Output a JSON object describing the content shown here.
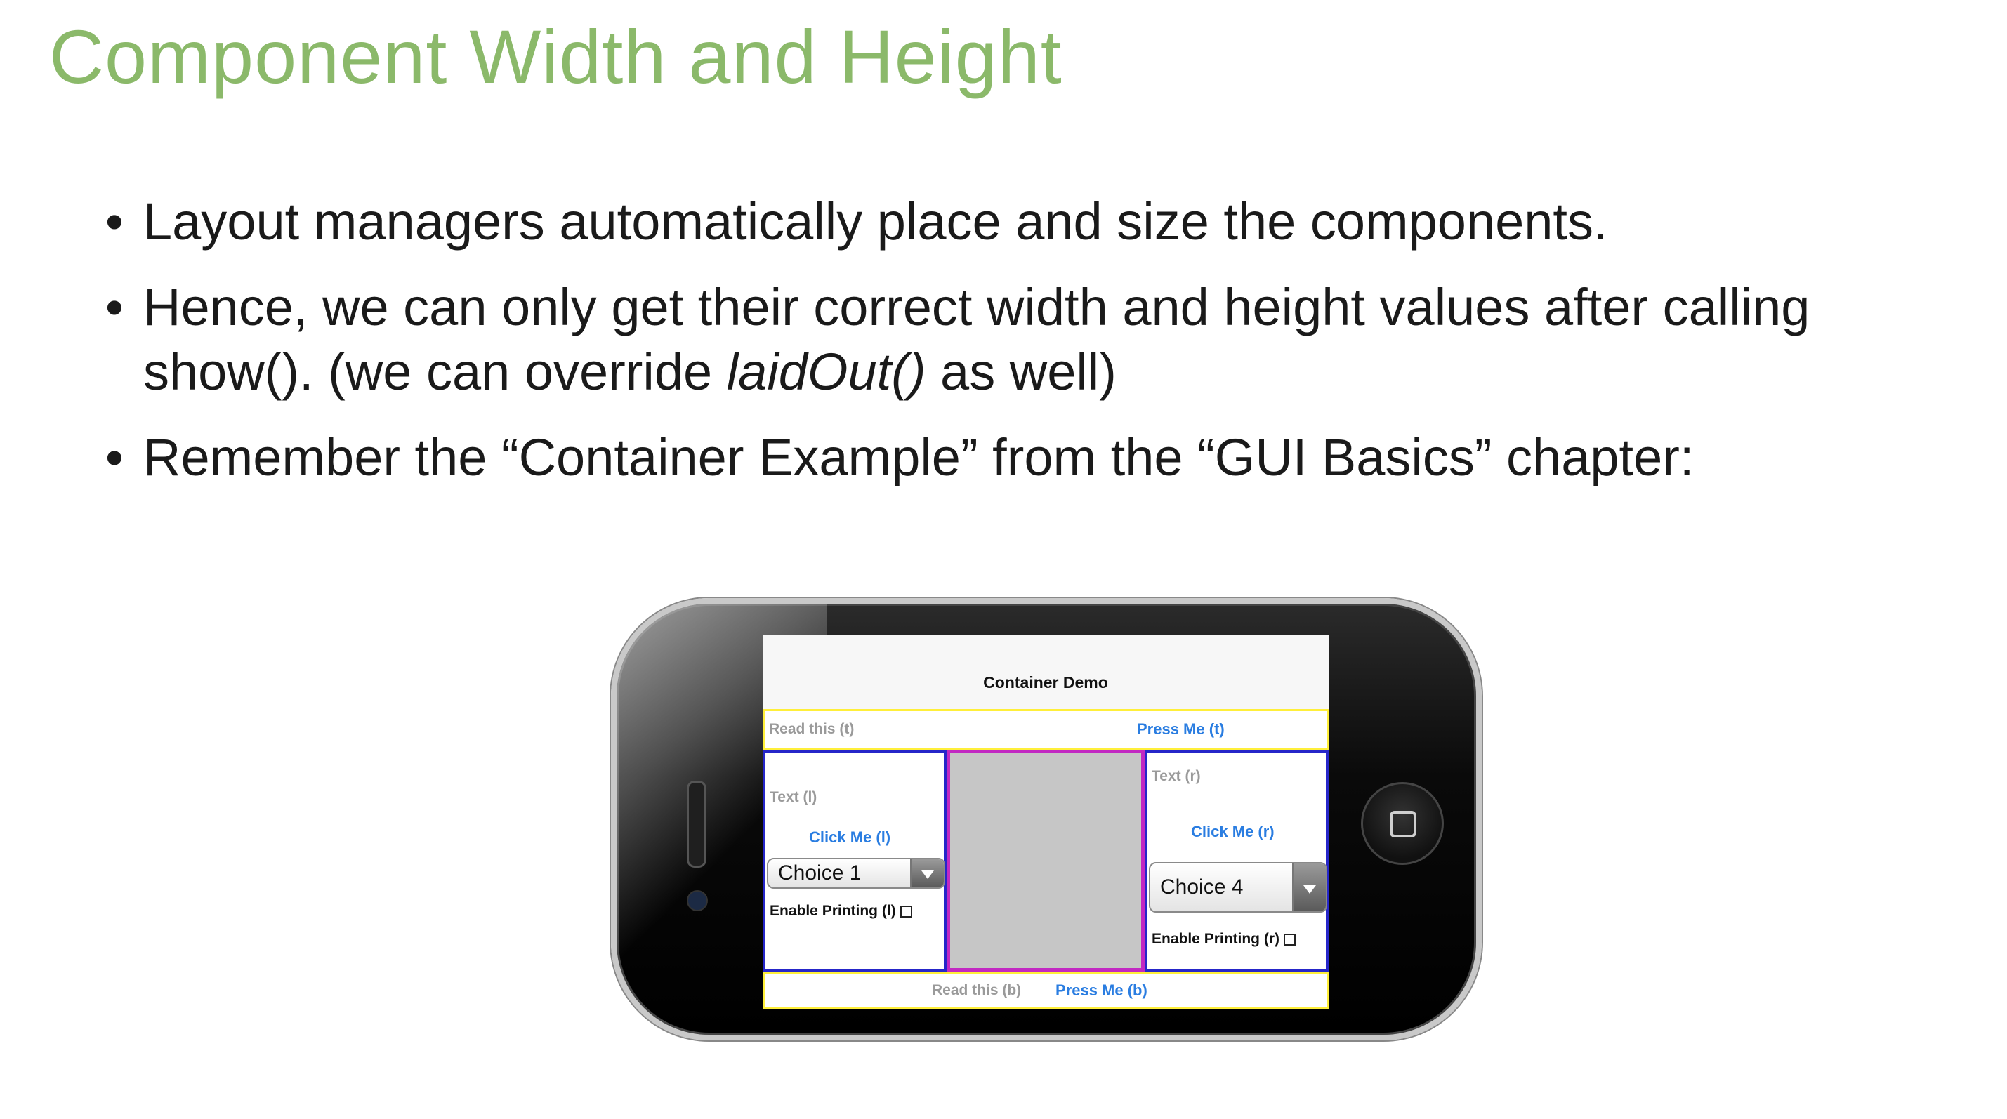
{
  "slide": {
    "title": "Component Width and Height",
    "bullets": [
      {
        "text": "Layout managers automatically place and size the components."
      },
      {
        "text_before": "Hence, we can only get their correct width and height values after calling show(). (we can override ",
        "text_italic": "laidOut()",
        "text_after": " as well)"
      },
      {
        "text": "Remember the “Container Example” from the “GUI Basics” chapter:"
      }
    ],
    "bullet_symbol": "•",
    "title_color": "#8bb96a"
  },
  "phone_screen": {
    "title": "Container Demo",
    "top": {
      "label": "Read this (t)",
      "button": "Press Me (t)"
    },
    "left": {
      "text": "Text (l)",
      "button": "Click Me (l)",
      "choice": "Choice 1",
      "checkbox_label": "Enable Printing (l)"
    },
    "right": {
      "text": "Text (r)",
      "button": "Click Me (r)",
      "choice": "Choice 4",
      "checkbox_label": "Enable Printing (r)"
    },
    "bottom": {
      "label": "Read this (b)",
      "button": "Press Me (b)"
    },
    "colors": {
      "edge_bar_border": "#ffef3a",
      "side_panel_border": "#2626c9",
      "center_panel_border": "#c228c2",
      "center_panel_fill": "#c6c6c6",
      "button_text": "#2a7de1"
    },
    "icons": {
      "dropdown": "chevron-down-icon",
      "home": "home-button-icon"
    }
  }
}
